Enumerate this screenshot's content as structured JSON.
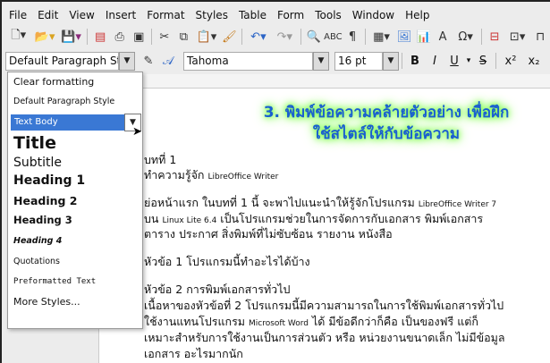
{
  "menubar": [
    "File",
    "Edit",
    "View",
    "Insert",
    "Format",
    "Styles",
    "Table",
    "Form",
    "Tools",
    "Window",
    "Help"
  ],
  "toolbar2": {
    "style_value": "Default Paragraph Styl",
    "font_value": "Tahoma",
    "size_value": "16 pt",
    "bold": "B",
    "italic": "I",
    "underline": "U",
    "strike": "S",
    "superscript": "x²",
    "subscript": "x₂"
  },
  "dropdown": {
    "items": [
      "Clear formatting",
      "Default Paragraph Style",
      "Text Body",
      "Title",
      "Subtitle",
      "Heading 1",
      "Heading 2",
      "Heading 3",
      "Heading 4",
      "Quotations",
      "Preformatted Text",
      "More Styles..."
    ]
  },
  "banner": {
    "line1": "3. พิมพ์ข้อความคล้ายตัวอย่าง เพื่อฝึก",
    "line2": "ใช้สไตล์ให้กับข้อความ"
  },
  "document": {
    "l1": "บทที่ 1",
    "l2a": "ทำความรู้จัก ",
    "l2b": "LibreOffice Writer",
    "l3a": "ย่อหน้าแรก ในบทที่ 1 นี้ จะพาไปแนะนำให้รู้จักโปรแกรม ",
    "l3b": "LibreOffice Writer 7",
    "l4a": "บน ",
    "l4b": "Linux Lite 6.4",
    "l4c": " เป็นโปรแกรมช่วยในการจัดการกับเอกสาร พิมพ์เอกสาร",
    "l5": "ตาราง ประกาศ สิ่งพิมพ์ที่ไม่ซับซ้อน รายงาน หนังสือ",
    "l6": "หัวข้อ 1 โปรแกรมนี้ทำอะไรได้บ้าง",
    "l7": "หัวข้อ 2 การพิมพ์เอกสารทั่วไป",
    "l8": "เนื้อหาของหัวข้อที่ 2 โปรแกรมนี้มีความสามารถในการใช้พิมพ์เอกสารทั่วไป",
    "l9a": "ใช้งานแทนโปรแกรม ",
    "l9b": "Microsoft Word",
    "l9c": " ได้ มีข้อดีกว่าก็คือ เป็นของฟรี แต่ก็",
    "l10": "เหมาะสำหรับการใช้งานเป็นการส่วนตัว หรือ หน่วยงานขนาดเล็ก ไม่มีข้อมูล",
    "l11": "เอกสาร อะไรมากนัก"
  }
}
